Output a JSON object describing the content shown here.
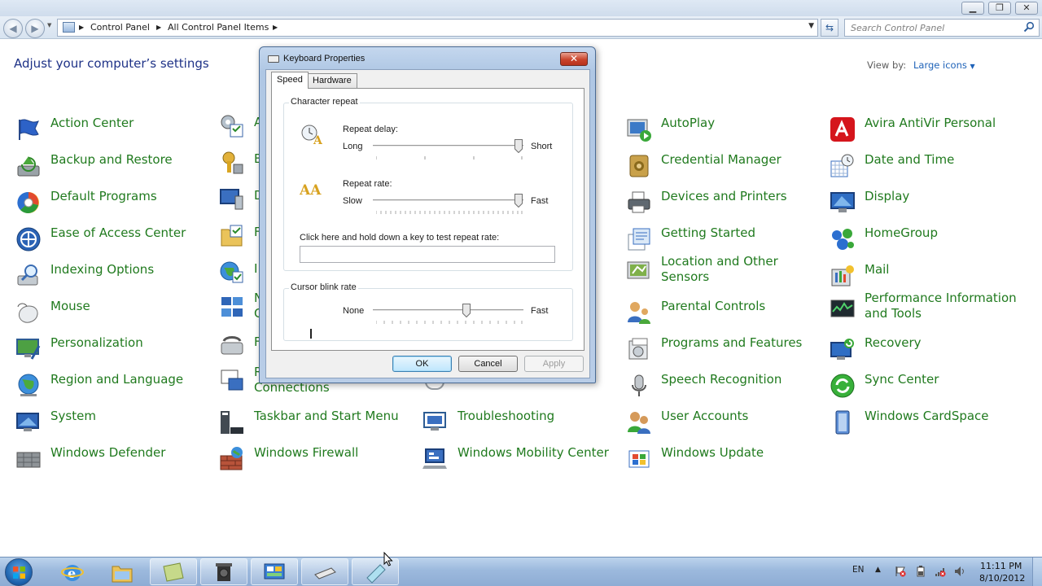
{
  "window": {
    "title_buttons": [
      "minimize-icon",
      "maximize-icon",
      "close-icon"
    ],
    "address": {
      "crumbs": [
        "Control Panel",
        "All Control Panel Items"
      ],
      "search_placeholder": "Search Control Panel"
    }
  },
  "control_panel": {
    "heading": "Adjust your computer’s settings",
    "view_by_label": "View by:",
    "view_by_value": "Large icons",
    "items": [
      {
        "label": "Action Center",
        "icon": "flag-icon"
      },
      {
        "label": "Backup and Restore",
        "icon": "backup-icon"
      },
      {
        "label": "Default Programs",
        "icon": "default-programs-icon"
      },
      {
        "label": "Ease of Access Center",
        "icon": "ease-of-access-icon"
      },
      {
        "label": "Indexing Options",
        "icon": "indexing-icon"
      },
      {
        "label": "Mouse",
        "icon": "mouse-icon"
      },
      {
        "label": "Personalization",
        "icon": "personalization-icon"
      },
      {
        "label": "Region and Language",
        "icon": "globe-icon"
      },
      {
        "label": "System",
        "icon": "system-icon"
      },
      {
        "label": "Windows Defender",
        "icon": "defender-icon"
      },
      {
        "label": "Connections",
        "icon": ""
      },
      {
        "label": "Taskbar and Start Menu",
        "icon": "taskbar-icon"
      },
      {
        "label": "Windows Firewall",
        "icon": "firewall-icon"
      },
      {
        "label": "Troubleshooting",
        "icon": "troubleshooting-icon"
      },
      {
        "label": "Windows Mobility Center",
        "icon": "mobility-icon"
      },
      {
        "label": "AutoPlay",
        "icon": "autoplay-icon"
      },
      {
        "label": "Credential Manager",
        "icon": "credential-icon"
      },
      {
        "label": "Devices and Printers",
        "icon": "printer-icon"
      },
      {
        "label": "Getting Started",
        "icon": "getting-started-icon"
      },
      {
        "label": "Location and Other Sensors",
        "icon": "sensors-icon"
      },
      {
        "label": "Parental Controls",
        "icon": "parental-icon"
      },
      {
        "label": "Programs and Features",
        "icon": "programs-icon"
      },
      {
        "label": "Speech Recognition",
        "icon": "microphone-icon"
      },
      {
        "label": "User Accounts",
        "icon": "users-icon"
      },
      {
        "label": "Windows Update",
        "icon": "update-icon"
      },
      {
        "label": "Avira AntiVir Personal",
        "icon": "avira-icon"
      },
      {
        "label": "Date and Time",
        "icon": "clock-icon"
      },
      {
        "label": "Display",
        "icon": "display-icon"
      },
      {
        "label": "HomeGroup",
        "icon": "homegroup-icon"
      },
      {
        "label": "Mail",
        "icon": "mail-icon"
      },
      {
        "label": "Performance Information and Tools",
        "icon": "performance-icon"
      },
      {
        "label": "Recovery",
        "icon": "recovery-icon"
      },
      {
        "label": "Sync Center",
        "icon": "sync-icon"
      },
      {
        "label": "Windows CardSpace",
        "icon": "cardspace-icon"
      }
    ],
    "partial_left_letters": [
      "A",
      "B",
      "D",
      "F",
      "I",
      "N",
      "C",
      "F",
      "R"
    ]
  },
  "dialog": {
    "title": "Keyboard Properties",
    "tabs": [
      "Speed",
      "Hardware"
    ],
    "active_tab": "Speed",
    "character_repeat": {
      "group_title": "Character repeat",
      "delay_label": "Repeat delay:",
      "delay_min": "Long",
      "delay_max": "Short",
      "delay_value": 1.0,
      "rate_label": "Repeat rate:",
      "rate_min": "Slow",
      "rate_max": "Fast",
      "rate_value": 1.0,
      "test_label": "Click here and hold down a key to test repeat rate:",
      "test_value": ""
    },
    "cursor_blink": {
      "group_title": "Cursor blink rate",
      "min": "None",
      "max": "Fast",
      "value": 0.63
    },
    "buttons": {
      "ok": "OK",
      "cancel": "Cancel",
      "apply": "Apply"
    }
  },
  "taskbar": {
    "pinned": [
      "ie-icon",
      "explorer-icon",
      "notes-icon",
      "camera-icon",
      "control-panel-icon",
      "keyboard-icon",
      "tablet-icon"
    ],
    "language": "EN",
    "time": "11:11 PM",
    "date": "8/10/2012"
  },
  "colors": {
    "link_green": "#207a1e",
    "heading_blue": "#1e3287",
    "accent_blue": "#1e62b8"
  }
}
